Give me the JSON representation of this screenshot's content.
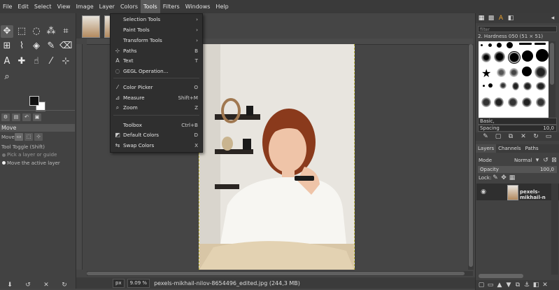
{
  "menubar": [
    "File",
    "Edit",
    "Select",
    "View",
    "Image",
    "Layer",
    "Colors",
    "Tools",
    "Filters",
    "Windows",
    "Help"
  ],
  "menu_active": "Tools",
  "tools_menu": {
    "items": [
      {
        "icon": "",
        "label": "Selection Tools",
        "shortcut": "›"
      },
      {
        "icon": "",
        "label": "Paint Tools",
        "shortcut": "›"
      },
      {
        "icon": "",
        "label": "Transform Tools",
        "shortcut": "›"
      },
      {
        "icon": "⊹",
        "label": "Paths",
        "shortcut": "B"
      },
      {
        "icon": "A",
        "label": "Text",
        "shortcut": "T"
      },
      {
        "icon": "◌",
        "label": "GEGL Operation...",
        "shortcut": ""
      },
      {
        "icon": "⁄",
        "label": "Color Picker",
        "shortcut": "O"
      },
      {
        "icon": "⊿",
        "label": "Measure",
        "shortcut": "Shift+M"
      },
      {
        "icon": "⌕",
        "label": "Zoom",
        "shortcut": "Z"
      },
      {
        "icon": "",
        "label": "Toolbox",
        "shortcut": "Ctrl+B"
      },
      {
        "icon": "◩",
        "label": "Default Colors",
        "shortcut": "D"
      },
      {
        "icon": "⇆",
        "label": "Swap Colors",
        "shortcut": "X"
      }
    ]
  },
  "tool_options": {
    "title": "Move",
    "move_label": "Move:",
    "toggle_label": "Tool Toggle  (Shift)",
    "option_pick": "Pick a layer or guide",
    "option_move": "Move the active layer"
  },
  "status": {
    "unit": "px",
    "zoom": "9.09 %",
    "file": "pexels-mikhail-nilov-8654496_edited.jpg (244,3 MB)"
  },
  "brushes": {
    "filter_placeholder": "filter",
    "brush_name": "2. Hardness 050 (51 × 51)",
    "preset": "Basic,",
    "spacing_label": "Spacing",
    "spacing_value": "10,0"
  },
  "layers": {
    "tabs": [
      "Layers",
      "Channels",
      "Paths"
    ],
    "mode_label": "Mode",
    "mode_value": "Normal",
    "opacity_label": "Opacity",
    "opacity_value": "100,0",
    "lock_label": "Lock:",
    "layer_name": "pexels-mikhail-n"
  },
  "colors": {
    "fg": "#111111",
    "bg": "#ffffff",
    "menu_bg": "#2f2f2f"
  }
}
